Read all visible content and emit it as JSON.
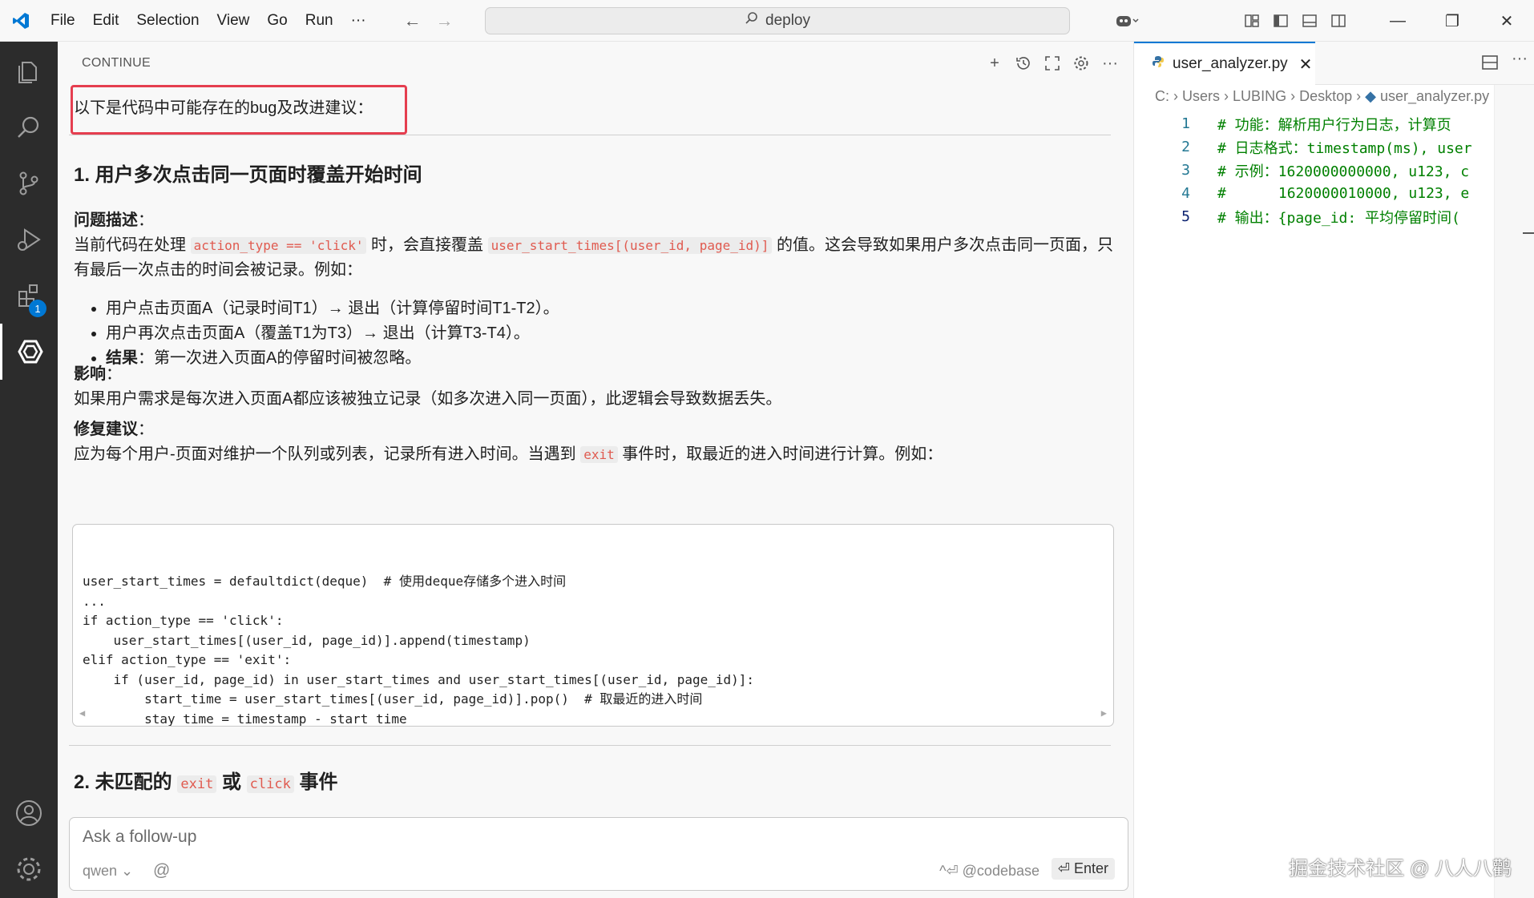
{
  "titlebar": {
    "menu": [
      "File",
      "Edit",
      "Selection",
      "View",
      "Go",
      "Run",
      "···"
    ],
    "search": "deploy"
  },
  "activity": {
    "extensions_badge": "1"
  },
  "panel": {
    "title": "CONTINUE",
    "intro": "以下是代码中可能存在的bug及改进建议：",
    "section1": {
      "heading": "1. 用户多次点击同一页面时覆盖开始时间",
      "problem_label": "问题描述",
      "problem_colon": "：",
      "problem_p1": "当前代码在处理 ",
      "problem_code1": "action_type == 'click'",
      "problem_p2": " 时，会直接覆盖 ",
      "problem_code2": "user_start_times[(user_id, page_id)]",
      "problem_p3": " 的值。这会导致如果用户多次点击同一页面，只有最后一次点击的时间会被记录。例如：",
      "bullets": [
        "用户点击页面A（记录时间T1）→ 退出（计算停留时间T1-T2）。",
        "用户再次点击页面A（覆盖T1为T3）→ 退出（计算T3-T4）。"
      ],
      "bullet3_label": "结果",
      "bullet3_text": "：第一次进入页面A的停留时间被忽略。",
      "impact_label": "影响",
      "impact_colon": "：",
      "impact_text": "如果用户需求是每次进入页面A都应该被独立记录（如多次进入同一页面），此逻辑会导致数据丢失。",
      "fix_label": "修复建议",
      "fix_colon": "：",
      "fix_p1": "应为每个用户-页面对维护一个队列或列表，记录所有进入时间。当遇到 ",
      "fix_code": "exit",
      "fix_p2": " 事件时，取最近的进入时间进行计算。例如：",
      "code": "user_start_times = defaultdict(deque)  # 使用deque存储多个进入时间\n...\nif action_type == 'click':\n    user_start_times[(user_id, page_id)].append(timestamp)\nelif action_type == 'exit':\n    if (user_id, page_id) in user_start_times and user_start_times[(user_id, page_id)]:\n        start_time = user_start_times[(user_id, page_id)].pop()  # 取最近的进入时间\n        stay_time = timestamp - start_time\n        page_stay_times[page_id].append(stay_time)"
    },
    "section2": {
      "heading_prefix": "2. 未匹配的 ",
      "code1": "exit",
      "mid": " 或 ",
      "code2": "click",
      "suffix": " 事件"
    },
    "chat": {
      "placeholder": "Ask a follow-up",
      "model": "qwen",
      "at": "@",
      "codebase_hint": "^⏎ @codebase",
      "enter": "⏎ Enter"
    }
  },
  "editor": {
    "tab_label": "user_analyzer.py",
    "breadcrumb": [
      "C:",
      "Users",
      "LUBING",
      "Desktop",
      "user_analyzer.py"
    ],
    "lines": [
      {
        "n": "1",
        "text": "# 功能：解析用户行为日志，计算页"
      },
      {
        "n": "2",
        "text": "# 日志格式：timestamp(ms), user"
      },
      {
        "n": "3",
        "text": "# 示例：1620000000000, u123, c"
      },
      {
        "n": "4",
        "text": "#      1620000010000, u123, e"
      },
      {
        "n": "5",
        "text": "# 输出：{page_id: 平均停留时间("
      }
    ]
  },
  "watermark": "掘金技术社区 @ 八人八鹳",
  "colors": {
    "accent": "#0078d4",
    "highlight": "#e53e4f",
    "inline_code": "#e05a4f",
    "comment": "#008000"
  }
}
